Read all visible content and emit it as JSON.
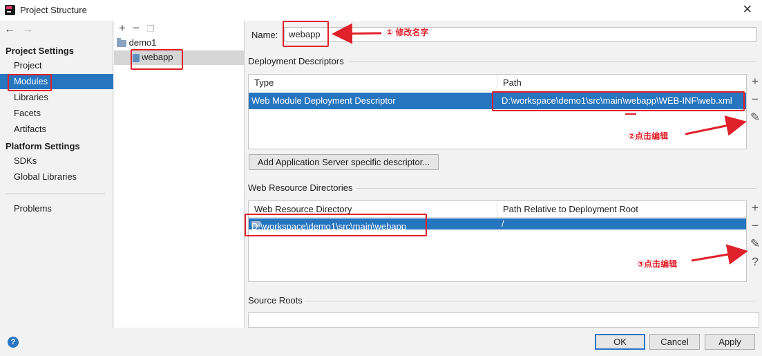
{
  "window": {
    "title": "Project Structure"
  },
  "nav": {
    "back": "←",
    "forward": "→"
  },
  "left_panel": {
    "project_settings_label": "Project Settings",
    "project_items": [
      "Project",
      "Modules",
      "Libraries",
      "Facets",
      "Artifacts"
    ],
    "platform_settings_label": "Platform Settings",
    "platform_items": [
      "SDKs",
      "Global Libraries"
    ],
    "problems_label": "Problems",
    "selected": "Modules"
  },
  "tree": {
    "add": "+",
    "remove": "−",
    "root": "demo1",
    "child": "webapp"
  },
  "main": {
    "name_label": "Name:",
    "name_value": "webapp",
    "deployment_title": "Deployment Descriptors",
    "deployment_headers": {
      "type": "Type",
      "path": "Path"
    },
    "deployment_row": {
      "type": "Web Module Deployment Descriptor",
      "path": "D:\\workspace\\demo1\\src\\main\\webapp\\WEB-INF\\web.xml"
    },
    "add_server_button": "Add Application Server specific descriptor...",
    "web_resource_title": "Web Resource Directories",
    "web_resource_headers": {
      "dir": "Web Resource Directory",
      "rel": "Path Relative to Deployment Root"
    },
    "web_resource_row": {
      "dir": "D:\\workspace\\demo1\\src\\main\\webapp",
      "rel": "/"
    },
    "source_roots_title": "Source Roots",
    "tool_add": "+",
    "tool_remove": "−",
    "tool_edit": "✎",
    "tool_help": "?"
  },
  "buttons": {
    "ok": "OK",
    "cancel": "Cancel",
    "apply": "Apply",
    "help": "?"
  },
  "annotations": {
    "step1": "① 修改名字",
    "step2": "②点击编辑",
    "step3": "③点击编辑"
  },
  "colors": {
    "selection": "#2675bf",
    "annotation_red": "#e0202a"
  }
}
